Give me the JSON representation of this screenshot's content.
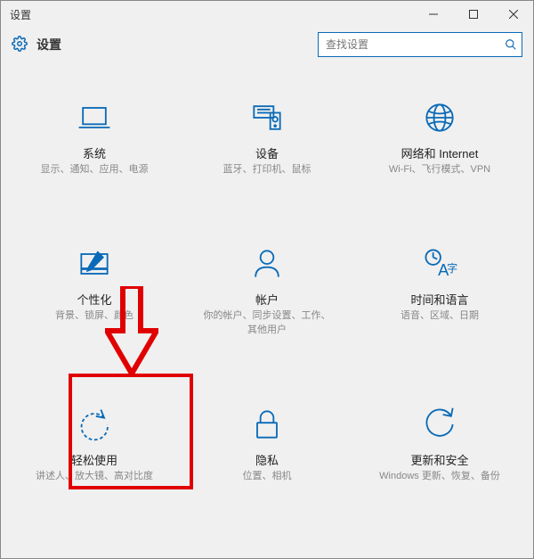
{
  "window": {
    "title": "设置"
  },
  "header": {
    "title": "设置"
  },
  "search": {
    "placeholder": "查找设置"
  },
  "tiles": [
    {
      "title": "系统",
      "desc": "显示、通知、应用、电源"
    },
    {
      "title": "设备",
      "desc": "蓝牙、打印机、鼠标"
    },
    {
      "title": "网络和 Internet",
      "desc": "Wi-Fi、飞行模式、VPN"
    },
    {
      "title": "个性化",
      "desc": "背景、锁屏、颜色"
    },
    {
      "title": "帐户",
      "desc": "你的帐户、同步设置、工作、其他用户"
    },
    {
      "title": "时间和语言",
      "desc": "语音、区域、日期"
    },
    {
      "title": "轻松使用",
      "desc": "讲述人、放大镜、高对比度"
    },
    {
      "title": "隐私",
      "desc": "位置、相机"
    },
    {
      "title": "更新和安全",
      "desc": "Windows 更新、恢复、备份"
    }
  ]
}
